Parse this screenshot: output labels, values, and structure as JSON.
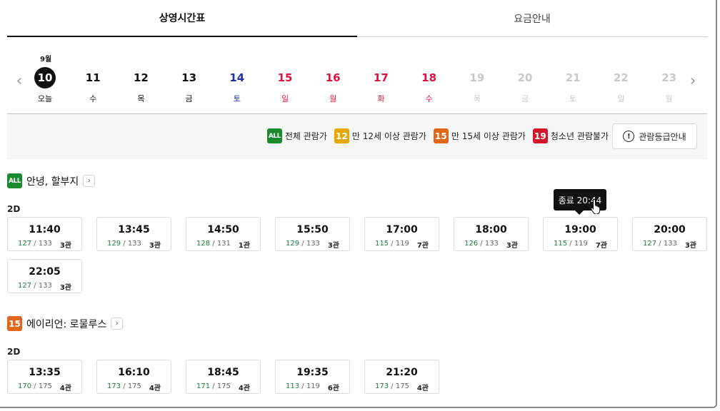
{
  "tabs": [
    {
      "label": "상영시간표",
      "active": true
    },
    {
      "label": "요금안내",
      "active": false
    }
  ],
  "month_label": "9월",
  "dates": [
    {
      "num": "10",
      "dow": "오늘",
      "color": "black",
      "selected": true
    },
    {
      "num": "11",
      "dow": "수",
      "color": "black"
    },
    {
      "num": "12",
      "dow": "목",
      "color": "black"
    },
    {
      "num": "13",
      "dow": "금",
      "color": "black"
    },
    {
      "num": "14",
      "dow": "토",
      "color": "blue"
    },
    {
      "num": "15",
      "dow": "일",
      "color": "red"
    },
    {
      "num": "16",
      "dow": "월",
      "color": "red"
    },
    {
      "num": "17",
      "dow": "화",
      "color": "red"
    },
    {
      "num": "18",
      "dow": "수",
      "color": "red"
    },
    {
      "num": "19",
      "dow": "목",
      "color": "gray"
    },
    {
      "num": "20",
      "dow": "금",
      "color": "gray"
    },
    {
      "num": "21",
      "dow": "토",
      "color": "gray"
    },
    {
      "num": "22",
      "dow": "일",
      "color": "gray"
    },
    {
      "num": "23",
      "dow": "월",
      "color": "gray"
    }
  ],
  "ratings": [
    {
      "badge": "ALL",
      "label": "전체 관람가",
      "color": "#1a8a2e"
    },
    {
      "badge": "12",
      "label": "만 12세 이상 관람가",
      "color": "#e5a800"
    },
    {
      "badge": "15",
      "label": "만 15세 이상 관람가",
      "color": "#e0661a"
    },
    {
      "badge": "19",
      "label": "청소년 관람불가",
      "color": "#d1152a"
    }
  ],
  "rating_guide_label": "관람등급안내",
  "movies": [
    {
      "rating": "ALL",
      "rating_color": "#1a8a2e",
      "title": "안녕, 할부지",
      "format": "2D",
      "showtimes": [
        {
          "time": "11:40",
          "remaining": "127",
          "total": "133",
          "hall": "3관"
        },
        {
          "time": "13:45",
          "remaining": "129",
          "total": "133",
          "hall": "3관"
        },
        {
          "time": "14:50",
          "remaining": "128",
          "total": "131",
          "hall": "1관"
        },
        {
          "time": "15:50",
          "remaining": "129",
          "total": "133",
          "hall": "3관"
        },
        {
          "time": "17:00",
          "remaining": "115",
          "total": "119",
          "hall": "7관"
        },
        {
          "time": "18:00",
          "remaining": "126",
          "total": "133",
          "hall": "3관"
        },
        {
          "time": "19:00",
          "remaining": "115",
          "total": "119",
          "hall": "7관"
        },
        {
          "time": "20:00",
          "remaining": "127",
          "total": "133",
          "hall": "3관"
        },
        {
          "time": "22:05",
          "remaining": "127",
          "total": "133",
          "hall": "3관"
        }
      ]
    },
    {
      "rating": "15",
      "rating_color": "#e0661a",
      "title": "에이리언: 로물루스",
      "format": "2D",
      "showtimes": [
        {
          "time": "13:35",
          "remaining": "170",
          "total": "175",
          "hall": "4관"
        },
        {
          "time": "16:10",
          "remaining": "173",
          "total": "175",
          "hall": "4관"
        },
        {
          "time": "18:45",
          "remaining": "171",
          "total": "175",
          "hall": "4관"
        },
        {
          "time": "19:35",
          "remaining": "113",
          "total": "119",
          "hall": "6관"
        },
        {
          "time": "21:20",
          "remaining": "173",
          "total": "175",
          "hall": "4관"
        }
      ]
    }
  ],
  "tooltip": {
    "text": "종료 20:44"
  },
  "icons": {
    "prev": "chevron-left-icon",
    "next": "chevron-right-icon",
    "info": "info-circle-icon",
    "cursor": "hand-pointer-icon"
  }
}
